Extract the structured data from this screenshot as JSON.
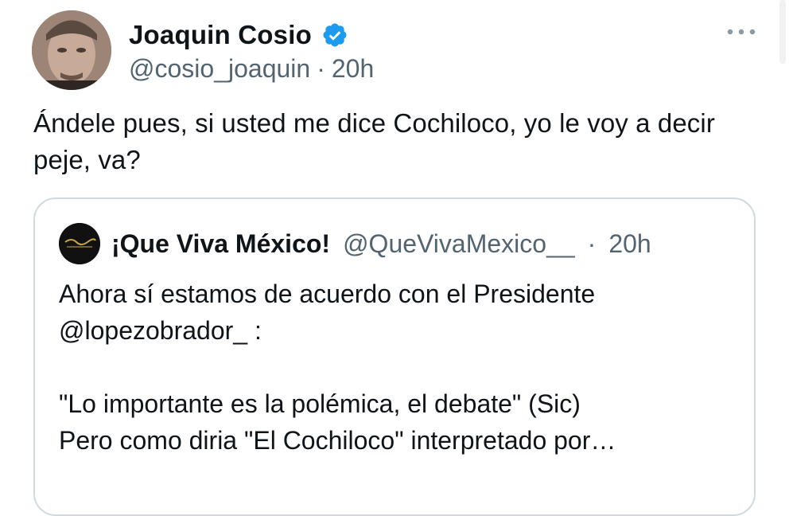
{
  "tweet": {
    "author_name": "Joaquin Cosio",
    "author_handle": "@cosio_joaquin",
    "separator": "·",
    "time": "20h",
    "text": "Ándele pues, si usted me dice Cochiloco, yo le voy a decir peje, va?",
    "verified": true,
    "accent_color": "#1d9bf0"
  },
  "quote": {
    "author_name": "¡Que Viva México!",
    "author_handle": "@QueVivaMexico__",
    "separator": "·",
    "time": "20h",
    "line1": "Ahora sí estamos de acuerdo con el Presidente",
    "line2": "@lopezobrador_ :",
    "line3": "\"Lo importante es la polémica, el debate\" (Sic)",
    "line4": "Pero como diria \"El Cochiloco\" interpretado por…"
  },
  "icons": {
    "verified": "verified-badge-icon",
    "more": "more-options-icon"
  }
}
